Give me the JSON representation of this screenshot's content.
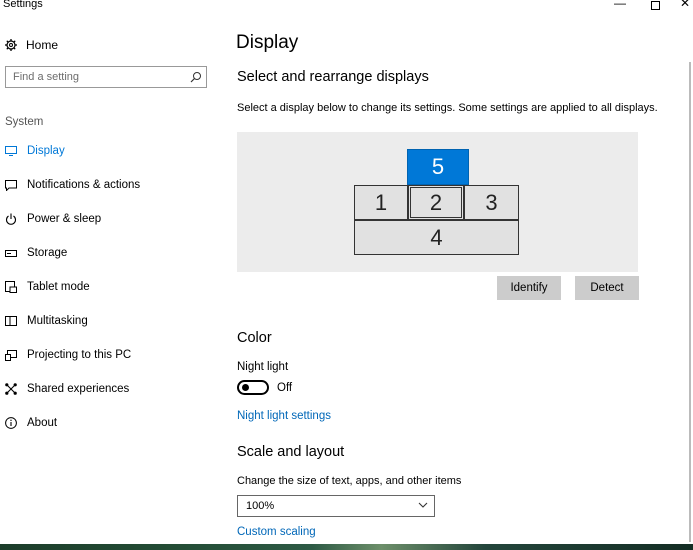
{
  "window": {
    "title": "Settings",
    "minimize": "—",
    "close": "✕"
  },
  "sidebar": {
    "home_label": "Home",
    "search_placeholder": "Find a setting",
    "section": "System",
    "items": [
      {
        "label": "Display",
        "icon": "monitor-icon",
        "active": true
      },
      {
        "label": "Notifications & actions",
        "icon": "notification-icon"
      },
      {
        "label": "Power & sleep",
        "icon": "power-icon"
      },
      {
        "label": "Storage",
        "icon": "storage-icon"
      },
      {
        "label": "Tablet mode",
        "icon": "tablet-mode-icon"
      },
      {
        "label": "Multitasking",
        "icon": "multitasking-icon"
      },
      {
        "label": "Projecting to this PC",
        "icon": "projecting-icon"
      },
      {
        "label": "Shared experiences",
        "icon": "shared-experiences-icon"
      },
      {
        "label": "About",
        "icon": "info-icon"
      }
    ]
  },
  "main": {
    "title": "Display",
    "arrange_heading": "Select and rearrange displays",
    "arrange_desc": "Select a display below to change its settings. Some settings are applied to all displays.",
    "monitors": [
      {
        "label": "5",
        "selected": true
      },
      {
        "label": "1"
      },
      {
        "label": "2"
      },
      {
        "label": "3"
      },
      {
        "label": "4"
      }
    ],
    "identify_label": "Identify",
    "detect_label": "Detect",
    "color_heading": "Color",
    "night_light_label": "Night light",
    "night_light_state": "Off",
    "night_light_link": "Night light settings",
    "scale_heading": "Scale and layout",
    "scale_desc": "Change the size of text, apps, and other items",
    "scale_value": "100%",
    "custom_scaling_link": "Custom scaling"
  },
  "colors": {
    "accent": "#0078d7",
    "link": "#0067b8",
    "panel": "#ececec",
    "button": "#cccccc"
  }
}
